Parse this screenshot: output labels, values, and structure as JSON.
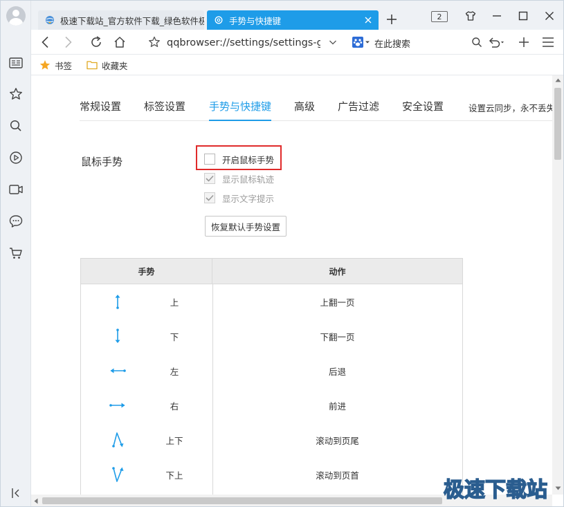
{
  "colors": {
    "accent": "#1e9ce8",
    "highlight_border": "#e02a2a",
    "sidebar_bg": "#eef1f5",
    "gesture_arrow": "#1e9ce8"
  },
  "tabs": [
    {
      "title": "极速下载站_官方软件下载_绿色软件极",
      "active": false,
      "icon": "globe-icon"
    },
    {
      "title": "手势与快捷键",
      "active": true,
      "icon": "gear-icon"
    }
  ],
  "tab_count": "2",
  "address_bar": {
    "url": "qqbrowser://settings/settings-ge",
    "search_placeholder": "在此搜索"
  },
  "bookmarks": {
    "bookmarks_label": "书签",
    "favorites_label": "收藏夹"
  },
  "settings_nav": {
    "items": [
      "常规设置",
      "标签设置",
      "手势与快捷键",
      "高级",
      "广告过滤",
      "安全设置"
    ],
    "active_index": 2,
    "sync_note": "设置云同步，永不丢失"
  },
  "mouse_gestures": {
    "section_label": "鼠标手势",
    "options": [
      {
        "label": "开启鼠标手势",
        "checked": false,
        "disabled": false
      },
      {
        "label": "显示鼠标轨迹",
        "checked": true,
        "disabled": true
      },
      {
        "label": "显示文字提示",
        "checked": true,
        "disabled": true
      }
    ],
    "restore_button": "恢复默认手势设置"
  },
  "gesture_table": {
    "headers": {
      "gesture": "手势",
      "action": "动作"
    },
    "rows": [
      {
        "gesture": "上",
        "action": "上翻一页",
        "icon": "arrow-up-icon"
      },
      {
        "gesture": "下",
        "action": "下翻一页",
        "icon": "arrow-down-icon"
      },
      {
        "gesture": "左",
        "action": "后退",
        "icon": "arrow-left-icon"
      },
      {
        "gesture": "右",
        "action": "前进",
        "icon": "arrow-right-icon"
      },
      {
        "gesture": "上下",
        "action": "滚动到页尾",
        "icon": "up-down-gesture-icon"
      },
      {
        "gesture": "下上",
        "action": "滚动到页首",
        "icon": "down-up-gesture-icon"
      }
    ]
  },
  "watermark": "极速下载站"
}
